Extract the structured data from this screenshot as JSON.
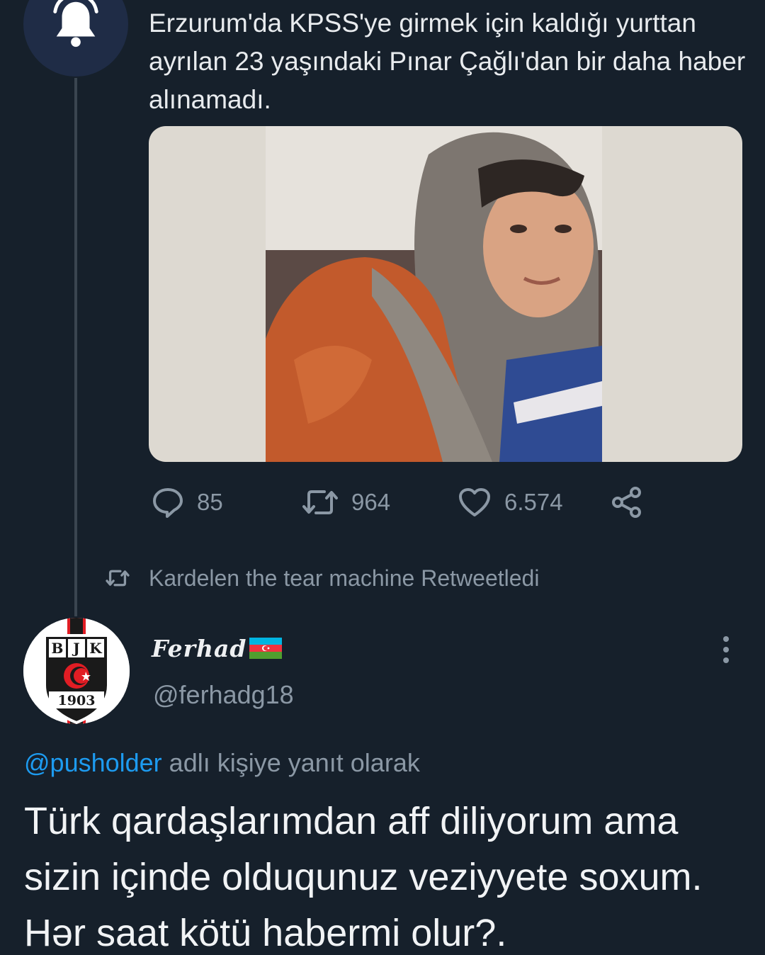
{
  "original_tweet": {
    "avatar_icon": "bell-icon",
    "text": "Erzurum'da KPSS'ye girmek için kaldığı yurttan ayrılan 23 yaşındaki Pınar Çağlı'dan bir daha haber alınamadı.",
    "actions": {
      "reply_count": "85",
      "retweet_count": "964",
      "like_count": "6.574"
    }
  },
  "retweet_notice": {
    "icon": "retweet-icon",
    "text": "Kardelen the tear machine Retweetledi"
  },
  "reply_tweet": {
    "avatar_text": {
      "letters": [
        "B",
        "J",
        "K"
      ],
      "year": "1903"
    },
    "author_name": "Ferhad",
    "author_flag": "azerbaijan-flag",
    "handle": "@ferhadg18",
    "reply_to_mention": "@pusholder",
    "reply_to_suffix": " adlı kişiye yanıt olarak",
    "text": "Türk qardaşlarımdan aff diliyorum ama sizin içinde olduqunuz veziyyete soxum. Hər saat kötü habermi olur?."
  },
  "colors": {
    "background": "#16202b",
    "muted": "#8b98a5",
    "link": "#1d9bf0",
    "avatar_bg": "#1f2c46"
  }
}
